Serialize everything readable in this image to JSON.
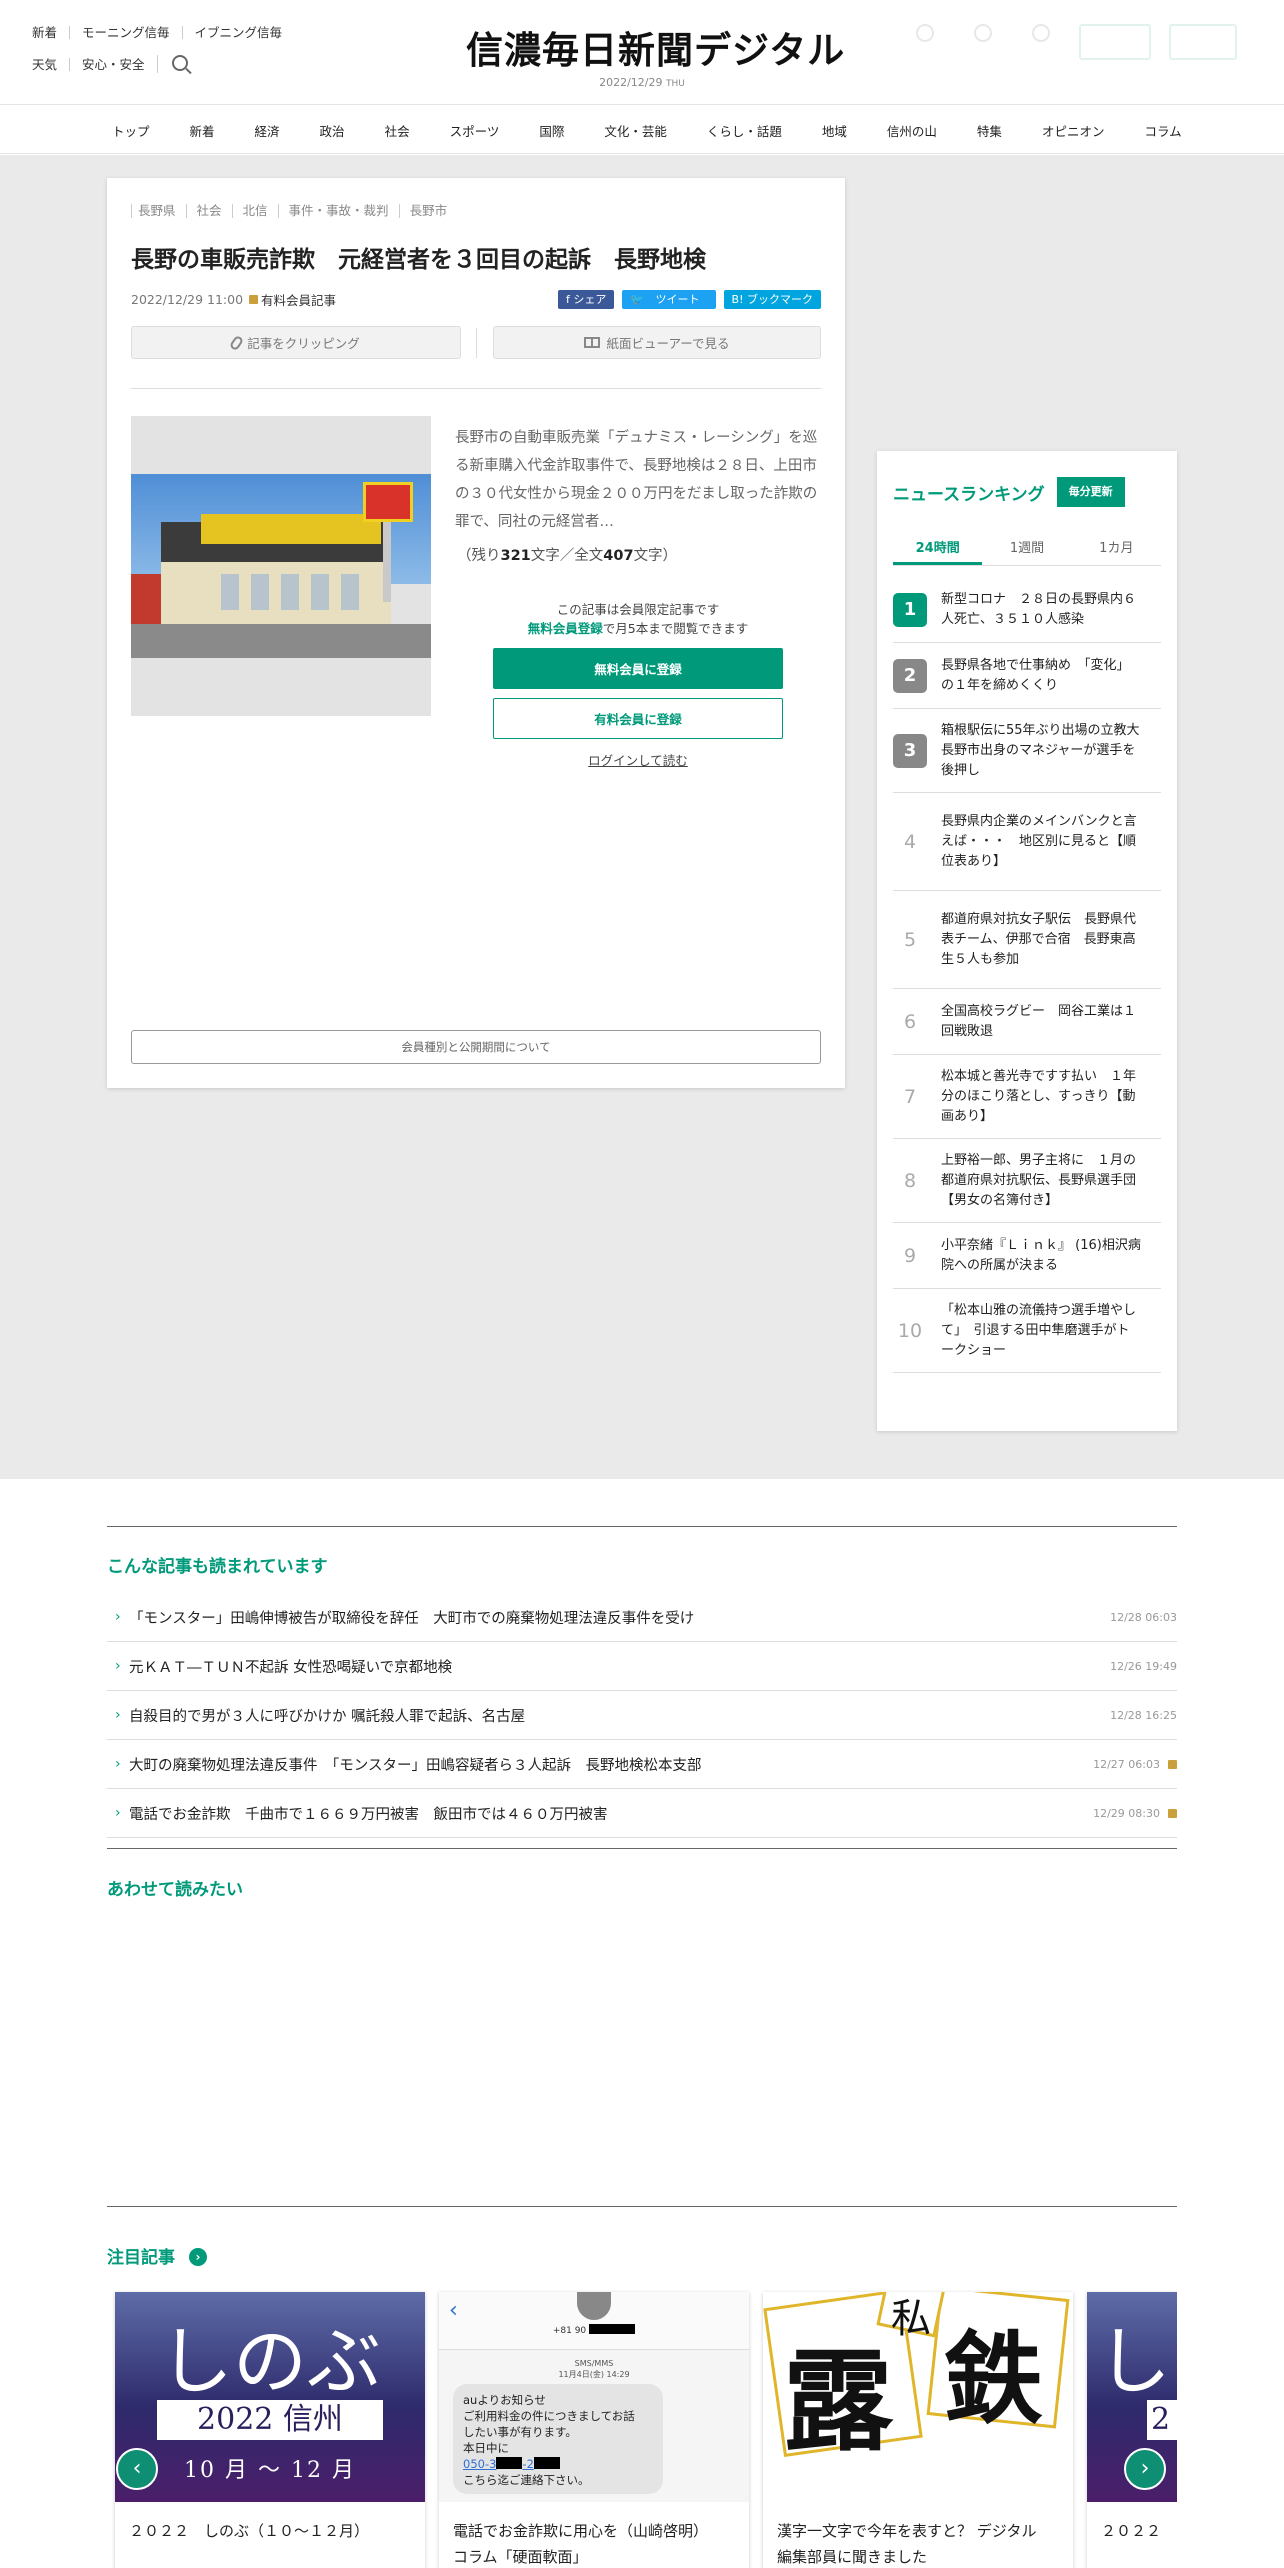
{
  "header": {
    "links_row1": [
      "新着",
      "モーニング信毎",
      "イブニング信毎"
    ],
    "links_row2": [
      "天気",
      "安心・安全"
    ],
    "logo": "信濃毎日新聞デジタル",
    "date": "2022/12/29",
    "weekday": "THU"
  },
  "nav": [
    "トップ",
    "新着",
    "経済",
    "政治",
    "社会",
    "スポーツ",
    "国際",
    "文化・芸能",
    "くらし・話題",
    "地域",
    "信州の山",
    "特集",
    "オピニオン",
    "コラム"
  ],
  "article": {
    "breadcrumbs": [
      "長野県",
      "社会",
      "北信",
      "事件・事故・裁判",
      "長野市"
    ],
    "title": "長野の車販売詐欺　元経営者を３回目の起訴　長野地検",
    "datetime": "2022/12/29 11:00",
    "paid_label": "有料会員記事",
    "share": {
      "facebook": "f シェア",
      "twitter": "ツイート",
      "hatena": "B! ブックマーク"
    },
    "clip_label": "記事をクリッピング",
    "viewer_label": "紙面ビューアーで見る",
    "lead": "長野市の自動車販売業「デュナミス・レーシング」を巡る新車購入代金詐取事件で、長野地検は２８日、上田市の３０代女性から現金２００万円をだまし取った詐欺の罪で、同社の元経営者…",
    "remain_prefix": "（残り",
    "remain_count": "321",
    "remain_mid": "文字／全文",
    "total_count": "407",
    "remain_suffix": "文字）",
    "limited_line1": "この記事は会員限定記事です",
    "limited_em": "無料会員登録",
    "limited_line2": "で月5本まで閲覧できます",
    "register_free": "無料会員に登録",
    "register_paid": "有料会員に登録",
    "login": "ログインして読む",
    "member_info": "会員種別と公開期間について"
  },
  "ranking": {
    "title": "ニュースランキング",
    "badge": "毎分更新",
    "tabs": [
      "24時間",
      "1週間",
      "1カ月"
    ],
    "items": [
      {
        "rank": "1",
        "lines": [
          "新型コロナ　２８日の長野県内６",
          "人死亡、３５１０人感染"
        ]
      },
      {
        "rank": "2",
        "lines": [
          "長野県各地で仕事納め　「変化」",
          "の１年を締めくくり"
        ]
      },
      {
        "rank": "3",
        "lines": [
          "箱根駅伝に55年ぶり出場の立教大",
          "長野市出身のマネジャーが選手を",
          "後押し"
        ]
      },
      {
        "rank": "4",
        "lines": [
          "長野県内企業のメインバンクと言",
          "えば・・・　地区別に見ると【順",
          "位表あり】"
        ]
      },
      {
        "rank": "5",
        "lines": [
          "都道府県対抗女子駅伝　長野県代",
          "表チーム、伊那で合宿　長野東高",
          "生５人も参加"
        ]
      },
      {
        "rank": "6",
        "lines": [
          "全国高校ラグビー　岡谷工業は１",
          "回戦敗退"
        ]
      },
      {
        "rank": "7",
        "lines": [
          "松本城と善光寺ですす払い　１年",
          "分のほこり落とし、すっきり【動",
          "画あり】"
        ]
      },
      {
        "rank": "8",
        "lines": [
          "上野裕一郎、男子主将に　１月の",
          "都道府県対抗駅伝、長野県選手団",
          "【男女の名簿付き】"
        ]
      },
      {
        "rank": "9",
        "lines": [
          "小平奈緒『Ｌｉｎｋ』 (16)相沢病",
          "院への所属が決まる"
        ]
      },
      {
        "rank": "10",
        "lines": [
          "「松本山雅の流儀持つ選手増やし",
          "て」　引退する田中隼磨選手がト",
          "ークショー"
        ]
      }
    ]
  },
  "also_read": {
    "title": "こんな記事も読まれています",
    "items": [
      {
        "text": "「モンスター」田嶋伸博被告が取締役を辞任　大町市での廃棄物処理法違反事件を受け",
        "date": "12/28 06:03",
        "locked": false
      },
      {
        "text": "元ＫＡＴ―ＴＵＮ不起訴 女性恐喝疑いで京都地検",
        "date": "12/26 19:49",
        "locked": false
      },
      {
        "text": "自殺目的で男が３人に呼びかけか 嘱託殺人罪で起訴、名古屋",
        "date": "12/28 16:25",
        "locked": false
      },
      {
        "text": "大町の廃棄物処理法違反事件　「モンスター」田嶋容疑者ら３人起訴　長野地検松本支部",
        "date": "12/27 06:03",
        "locked": true
      },
      {
        "text": "電話でお金詐欺　千曲市で１６６９万円被害　飯田市では４６０万円被害",
        "date": "12/29 08:30",
        "locked": true
      }
    ]
  },
  "together": {
    "title": "あわせて読みたい"
  },
  "featured": {
    "title": "注目記事",
    "cards": [
      {
        "caption": "２０２２　しのぶ（１０～１２月）",
        "img": {
          "big": "しのぶ",
          "year": "2022 信州",
          "months": "10 月 ～ 12 月"
        }
      },
      {
        "caption_lines": [
          "電話でお金詐欺に用心を（山崎啓明）",
          "コラム「硬面軟面」"
        ],
        "img": {
          "number": "+81 90",
          "sms_label": "SMS/MMS",
          "sms_date": "11月4日(金) 14:29",
          "lines": [
            "auよりお知らせ",
            "ご利用料金の件につきましてお話",
            "したい事が有ります。",
            "本日中に"
          ],
          "link": "050-3",
          "link_sep": "-2",
          "last": "こちら迄ご連絡下さい。"
        }
      },
      {
        "caption_lines": [
          "漢字一文字で今年を表すと？ デジタル",
          "編集部員に聞きました"
        ],
        "img": {
          "k1": "露",
          "k2": "鉄",
          "k3": "私"
        }
      },
      {
        "caption": "２０２２",
        "img": {
          "big": "し",
          "year": "2"
        }
      }
    ]
  }
}
